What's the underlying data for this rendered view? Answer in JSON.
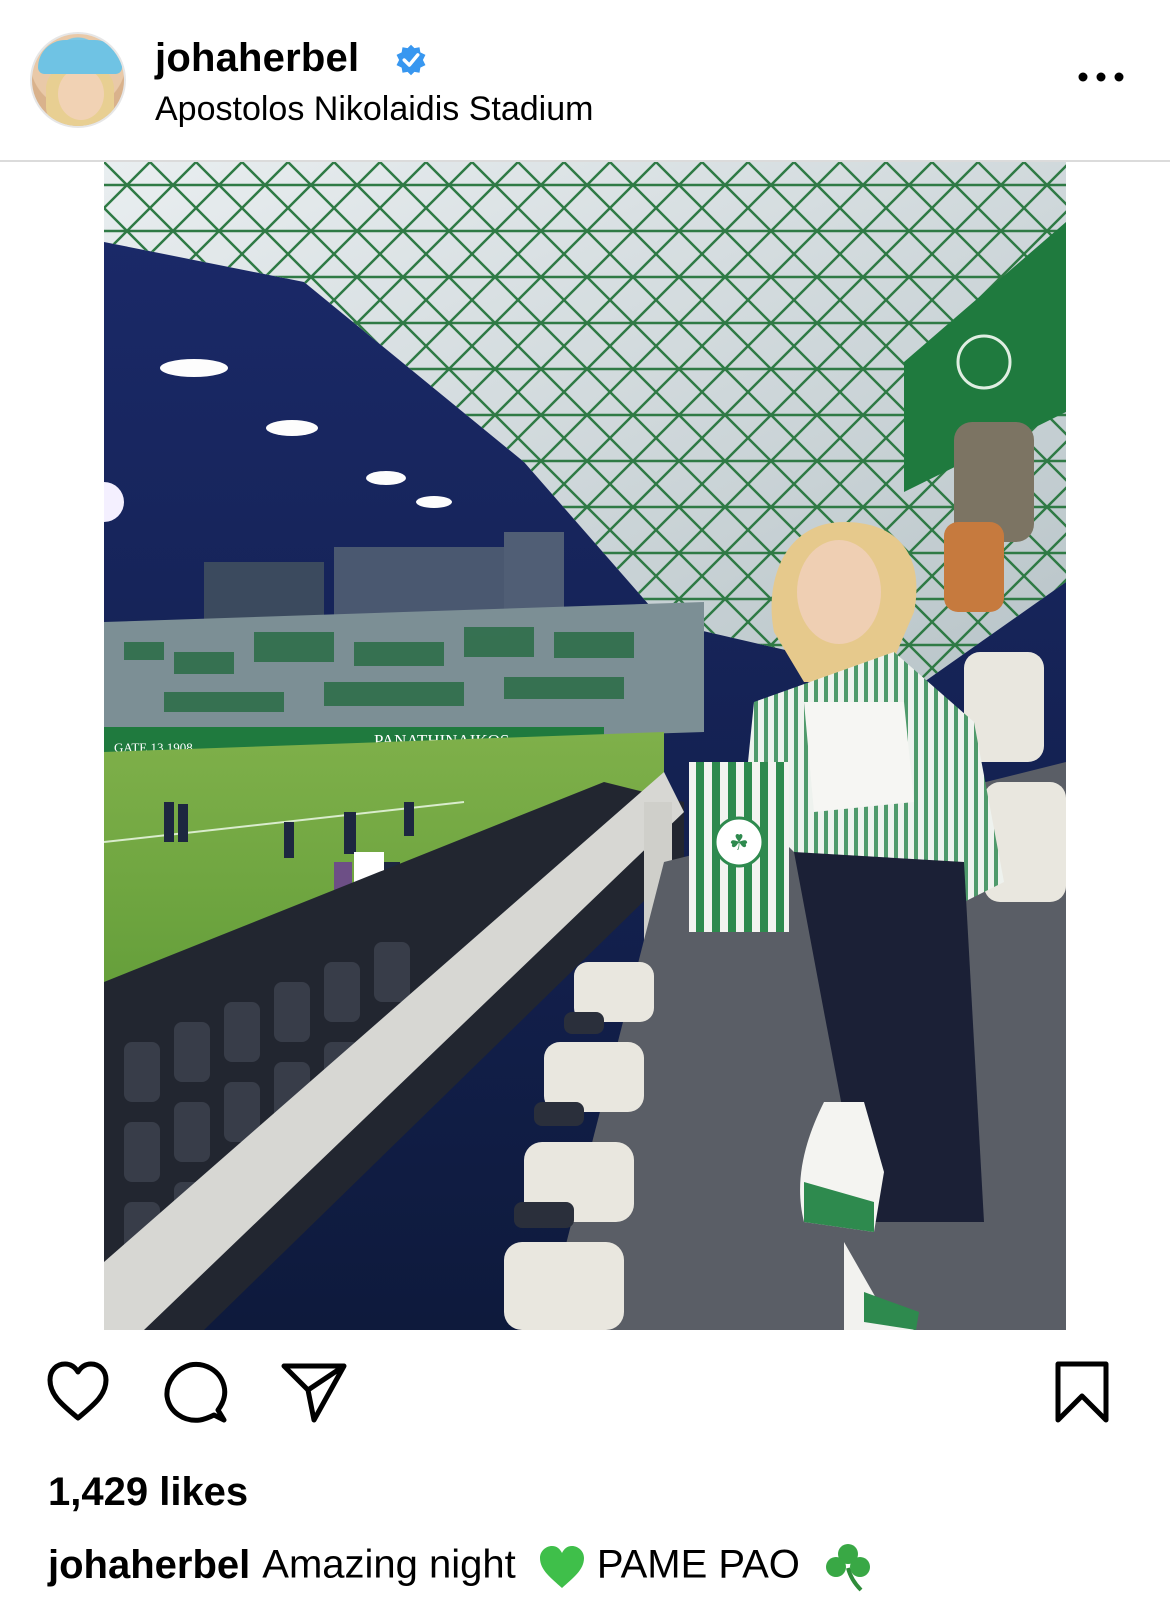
{
  "post": {
    "username": "johaherbel",
    "location": "Apostolos Nikolaidis Stadium",
    "verified": true,
    "likes": "1,429 likes",
    "caption": {
      "username": "johaherbel",
      "text_before": "Amazing night",
      "text_after": "PAME PAO",
      "emojis": [
        "green-heart-icon",
        "shamrock-icon"
      ]
    }
  },
  "photo": {
    "stadium_sign": "PANATHINAIKOS",
    "gate_sign": "GATE 13 1908"
  },
  "actions": [
    "like-icon",
    "comment-icon",
    "share-icon",
    "save-icon"
  ],
  "colors": {
    "verified_blue": "#3897f0",
    "team_green": "#1f7a3e"
  }
}
